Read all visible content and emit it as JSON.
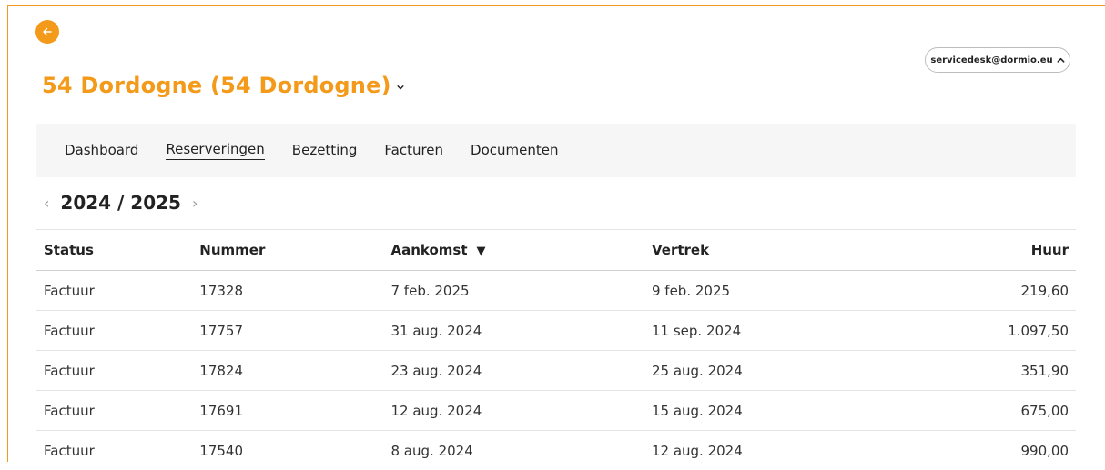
{
  "header": {
    "back_icon": "arrow-left-icon",
    "title": "54 Dordogne (54 Dordogne)",
    "user_email": "servicedesk@dormio.eu"
  },
  "nav": {
    "items": [
      {
        "label": "Dashboard",
        "active": false
      },
      {
        "label": "Reserveringen",
        "active": true
      },
      {
        "label": "Bezetting",
        "active": false
      },
      {
        "label": "Facturen",
        "active": false
      },
      {
        "label": "Documenten",
        "active": false
      }
    ]
  },
  "year_selector": {
    "label": "2024 / 2025",
    "prev_glyph": "‹",
    "next_glyph": "›"
  },
  "table": {
    "columns": [
      "Status",
      "Nummer",
      "Aankomst",
      "Vertrek",
      "Huur"
    ],
    "sort_indicator": "▼",
    "rows": [
      [
        "Factuur",
        "17328",
        "7 feb. 2025",
        "9 feb. 2025",
        "219,60"
      ],
      [
        "Factuur",
        "17757",
        "31 aug. 2024",
        "11 sep. 2024",
        "1.097,50"
      ],
      [
        "Factuur",
        "17824",
        "23 aug. 2024",
        "25 aug. 2024",
        "351,90"
      ],
      [
        "Factuur",
        "17691",
        "12 aug. 2024",
        "15 aug. 2024",
        "675,00"
      ],
      [
        "Factuur",
        "17540",
        "8 aug. 2024",
        "12 aug. 2024",
        "990,00"
      ]
    ]
  },
  "colors": {
    "accent": "#f39a1a"
  }
}
